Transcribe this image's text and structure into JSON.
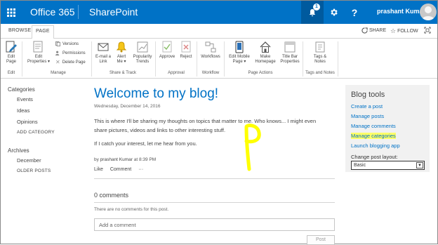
{
  "suitebar": {
    "brand": "Office 365",
    "app": "SharePoint",
    "notifications_count": "1",
    "username": "prashant Kumar"
  },
  "tabs": {
    "browse": "BROWSE",
    "page": "PAGE",
    "share": "SHARE",
    "follow": "FOLLOW"
  },
  "ribbon": {
    "edit_page": "Edit Page",
    "edit_properties": [
      "Edit",
      "Properties ▾"
    ],
    "versions": "Versions",
    "permissions": "Permissions",
    "delete_page": "Delete Page",
    "email_link": [
      "E-mail a",
      "Link"
    ],
    "alert_me": [
      "Alert",
      "Me ▾"
    ],
    "popularity_trends": [
      "Popularity",
      "Trends"
    ],
    "approve": "Approve",
    "reject": "Reject",
    "workflows": "Workflows",
    "edit_mobile_page": [
      "Edit Mobile",
      "Page ▾"
    ],
    "make_homepage": [
      "Make",
      "Homepage"
    ],
    "title_bar_properties": [
      "Title Bar",
      "Properties"
    ],
    "tags_notes": [
      "Tags &",
      "Notes"
    ],
    "groups": {
      "edit": "Edit",
      "manage": "Manage",
      "share_track": "Share & Track",
      "approval": "Approval",
      "workflow": "Workflow",
      "page_actions": "Page Actions",
      "tags_notes": "Tags and Notes"
    }
  },
  "leftnav": {
    "categories_heading": "Categories",
    "categories": [
      "Events",
      "Ideas",
      "Opinions"
    ],
    "add_category": "ADD CATEGORY",
    "archives_heading": "Archives",
    "archives": [
      "December"
    ],
    "older_posts": "OLDER POSTS"
  },
  "post": {
    "title": "Welcome to my blog!",
    "date": "Wednesday, December 14, 2016",
    "para1_line1": "This is where I'll be sharing my thoughts on topics that matter to me. Who knows... I might even",
    "para1_line2": "share pictures, videos and links to other interesting stuff.",
    "para2": "If I catch your interest, let me hear from you.",
    "by": "by",
    "author": "prashant Kumar",
    "at": "at",
    "time": "8:39 PM",
    "like": "Like",
    "comment": "Comment",
    "more": "···"
  },
  "comments": {
    "heading": "0 comments",
    "none": "There are no comments for this post.",
    "placeholder": "Add a comment",
    "post_button": "Post"
  },
  "blogtools": {
    "heading": "Blog tools",
    "links": [
      "Create a post",
      "Manage posts",
      "Manage comments",
      "Manage categories",
      "Launch blogging app"
    ],
    "layout_label": "Change post layout:",
    "layout_value": "Basic"
  },
  "colors": {
    "suitebar": "#0072c6",
    "link": "#0072c6",
    "highlight": "#ffff66",
    "annotation": "#ffff00"
  }
}
